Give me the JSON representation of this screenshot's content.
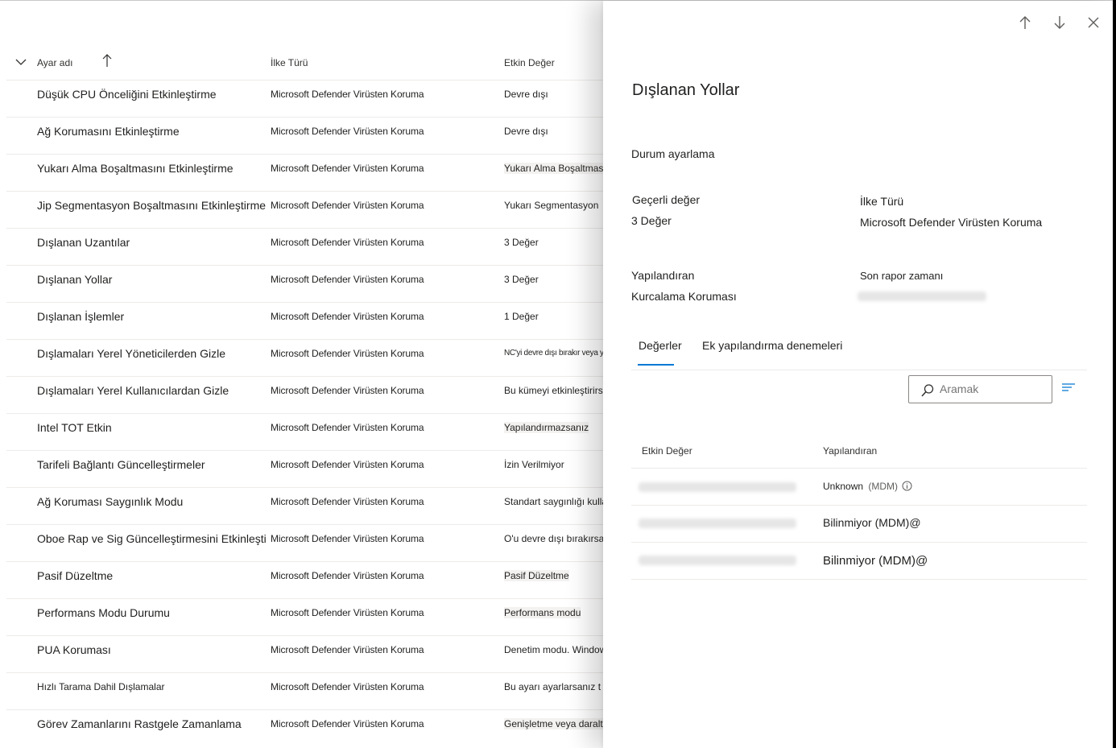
{
  "list": {
    "columns": {
      "name": "Ayar adı",
      "type": "İlke Türü",
      "value": "Etkin Değer"
    },
    "rows": [
      {
        "name": "Düşük CPU Önceliğini Etkinleştirme",
        "type": "Microsoft Defender Virüsten Koruma",
        "value": "Devre dışı"
      },
      {
        "name": "Ağ Korumasını Etkinleştirme",
        "type": "Microsoft Defender Virüsten Koruma",
        "value": "Devre dışı"
      },
      {
        "name": "Yukarı Alma Boşaltmasını Etkinleştirme",
        "type": "Microsoft Defender Virüsten Koruma",
        "value": "Yukarı Alma Boşaltması"
      },
      {
        "name": "Jip Segmentasyon Boşaltmasını Etkinleştirme",
        "type": "Microsoft Defender Virüsten Koruma",
        "value": "Yukarı Segmentasyon"
      },
      {
        "name": "Dışlanan Uzantılar",
        "type": "Microsoft Defender Virüsten Koruma",
        "value": "3 Değer"
      },
      {
        "name": "Dışlanan Yollar",
        "type": "Microsoft Defender Virüsten Koruma",
        "value": "3 Değer"
      },
      {
        "name": "Dışlanan İşlemler",
        "type": "Microsoft Defender Virüsten Koruma",
        "value": "1 Değer"
      },
      {
        "name": "Dışlamaları Yerel Yöneticilerden Gizle",
        "type": "Microsoft Defender Virüsten Koruma",
        "value": "NC'yi devre dışı bırakır veya yaparsanız"
      },
      {
        "name": "Dışlamaları Yerel Kullanıcılardan Gizle",
        "type": "Microsoft Defender Virüsten Koruma",
        "value": "Bu kümeyi etkinleştirirseniz"
      },
      {
        "name": "Intel TOT Etkin",
        "type": "Microsoft Defender Virüsten Koruma",
        "value": "Yapılandırmazsanız"
      },
      {
        "name": "Tarifeli Bağlantı Güncelleştirmeler",
        "type": "Microsoft Defender Virüsten Koruma",
        "value": "İzin Verilmiyor"
      },
      {
        "name": "Ağ Koruması Saygınlık Modu",
        "type": "Microsoft Defender Virüsten Koruma",
        "value": "Standart saygınlığı kullanma"
      },
      {
        "name": "Oboe Rap ve Sig Güncelleştirmesini Etkinleştir",
        "type": "Microsoft Defender Virüsten Koruma",
        "value": "O'u devre dışı bırakırsanız"
      },
      {
        "name": "Pasif Düzeltme",
        "type": "Microsoft Defender Virüsten Koruma",
        "value": "Pasif Düzeltme"
      },
      {
        "name": "Performans Modu Durumu",
        "type": "Microsoft Defender Virüsten Koruma",
        "value": "Performans modu"
      },
      {
        "name": "PUA Koruması",
        "type": "Microsoft Defender Virüsten Koruma",
        "value": "Denetim modu. Windows"
      },
      {
        "name": "Hızlı Tarama Dahil Dışlamalar",
        "type": "Microsoft Defender Virüsten Koruma",
        "value": "Bu ayarı ayarlarsanız t"
      },
      {
        "name": "Görev Zamanlarını Rastgele Zamanlama",
        "type": "Microsoft Defender Virüsten Koruma",
        "value": "Genişletme veya daraltma"
      }
    ]
  },
  "panel": {
    "title": "Dışlanan Yollar",
    "status_label": "Durum ayarlama",
    "current_value_label": "Geçerli değer",
    "current_value": "3 Değer",
    "policy_type_label": "İlke Türü",
    "policy_type": "Microsoft Defender Virüsten Koruma",
    "configured_by_label": "Yapılandıran",
    "configured_by": "Kurcalama Koruması",
    "last_report_label": "Son rapor zamanı",
    "tabs": [
      "Değerler",
      "Ek yapılandırma denemeleri"
    ],
    "search": {
      "placeholder": "Aramak"
    },
    "table": {
      "headers": [
        "Etkin Değer",
        "Yapılandıran"
      ],
      "rows": [
        {
          "configured_by": "Unknown",
          "suffix": "(MDM)"
        },
        {
          "configured_by": "Bilinmiyor (MDM)@"
        },
        {
          "configured_by": "Bilinmiyor (MDM)@"
        }
      ]
    }
  },
  "icons": {
    "header_chevron": "chevron-down-icon",
    "sort": "arrow-up-icon",
    "prev": "arrow-up-icon",
    "next": "arrow-down-icon",
    "close": "close-icon",
    "search": "search-icon",
    "filter": "filter-icon",
    "info": "info-icon"
  },
  "colors": {
    "accent": "#0078d4",
    "text": "#201f1e",
    "divider": "#edebe9"
  }
}
